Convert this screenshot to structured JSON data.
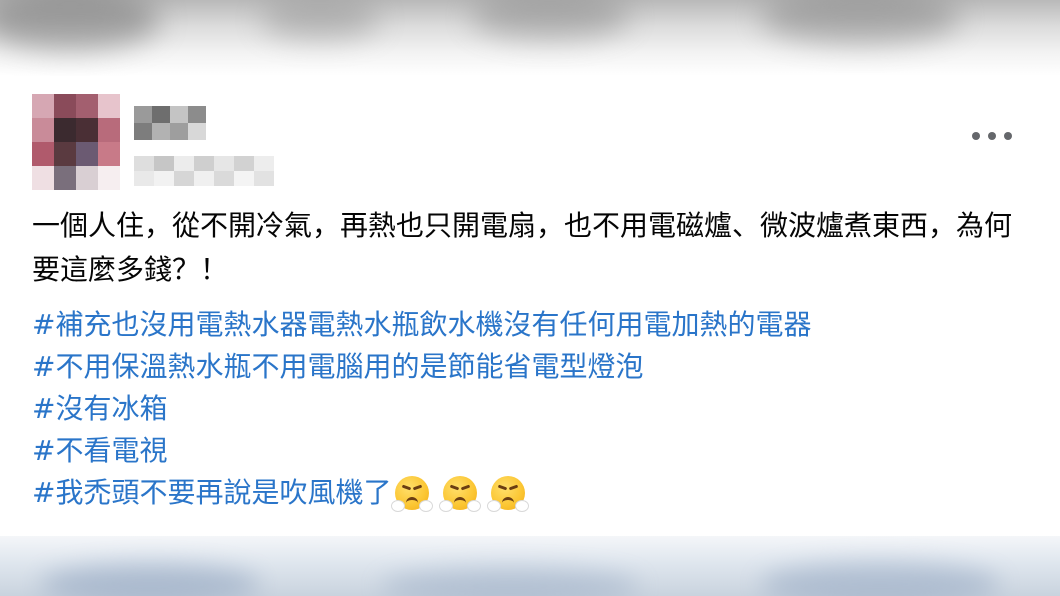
{
  "post": {
    "body": "一個人住，從不開冷氣，再熱也只開電扇，也不用電磁爐、微波爐煮東西，為何要這麼多錢？！",
    "hashtags": [
      "#補充也沒用電熱水器電熱水瓶飲水機沒有任何用電加熱的電器",
      "#不用保溫熱水瓶不用電腦用的是節能省電型燈泡",
      "#沒有冰箱",
      "#不看電視",
      "#我禿頭不要再說是吹風機了"
    ],
    "trailing_emoji": "face-with-steam-from-nose",
    "trailing_emoji_count": 3,
    "more_icon": "more-horizontal-icon"
  },
  "colors": {
    "hashtag": "#2a75c9",
    "text": "#050505",
    "icon": "#65676b"
  }
}
